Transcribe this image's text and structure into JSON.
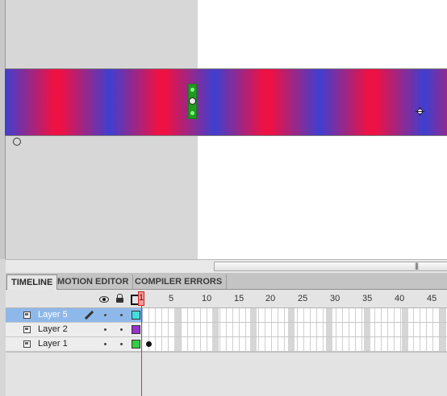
{
  "stage": {
    "gradient_colors": [
      "#ee1144",
      "#3f3fd0"
    ],
    "icons": {
      "registration": "registration-point-icon",
      "gradient_handle": "gradient-transform-handle-icon",
      "cursor": "crosshair-cursor-icon"
    }
  },
  "scrollbar": {
    "grip": "|||"
  },
  "tabs": [
    {
      "label": "TIMELINE",
      "active": true
    },
    {
      "label": "MOTION EDITOR",
      "active": false
    },
    {
      "label": "COMPILER ERRORS",
      "active": false
    }
  ],
  "timeline": {
    "header_icons": [
      "eye-icon",
      "lock-icon",
      "outline-icon"
    ],
    "current_frame": "1",
    "frame_numbers": [
      "5",
      "10",
      "15",
      "20",
      "25",
      "30",
      "35",
      "40",
      "45"
    ],
    "layers": [
      {
        "name": "Layer 5",
        "color": "#44dddd",
        "selected": true,
        "editing": true
      },
      {
        "name": "Layer 2",
        "color": "#9933cc",
        "selected": false,
        "editing": false
      },
      {
        "name": "Layer 1",
        "color": "#33cc44",
        "selected": false,
        "editing": false
      }
    ],
    "colors": {
      "playhead": "#e03030",
      "selected_row": "#8fb8ea"
    }
  }
}
